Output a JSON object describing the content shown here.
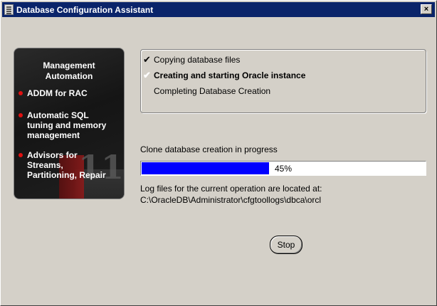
{
  "window": {
    "title": "Database Configuration Assistant"
  },
  "side_panel": {
    "title_line1": "Management",
    "title_line2": "Automation",
    "items": [
      {
        "lines": [
          "ADDM for RAC"
        ]
      },
      {
        "lines": [
          "Automatic SQL",
          "tuning and memory",
          "management"
        ]
      },
      {
        "lines": [
          "Advisors for",
          "Streams,",
          "Partitioning, Repair"
        ]
      }
    ]
  },
  "steps": [
    {
      "label": "Copying database files",
      "state": "done",
      "mark": "✔"
    },
    {
      "label": "Creating and starting Oracle instance",
      "state": "active",
      "mark": "✔"
    },
    {
      "label": "Completing Database Creation",
      "state": "pending",
      "mark": ""
    }
  ],
  "status": {
    "label": "Clone database creation in progress",
    "progress_percent": 45,
    "progress_text": "45%",
    "progress_color": "#0000ff"
  },
  "log": {
    "line1": "Log files for the current operation are located at:",
    "line2": "C:\\OracleDB\\Administrator\\cfgtoollogs\\dbca\\orcl"
  },
  "buttons": {
    "stop": "Stop",
    "close": "×"
  }
}
